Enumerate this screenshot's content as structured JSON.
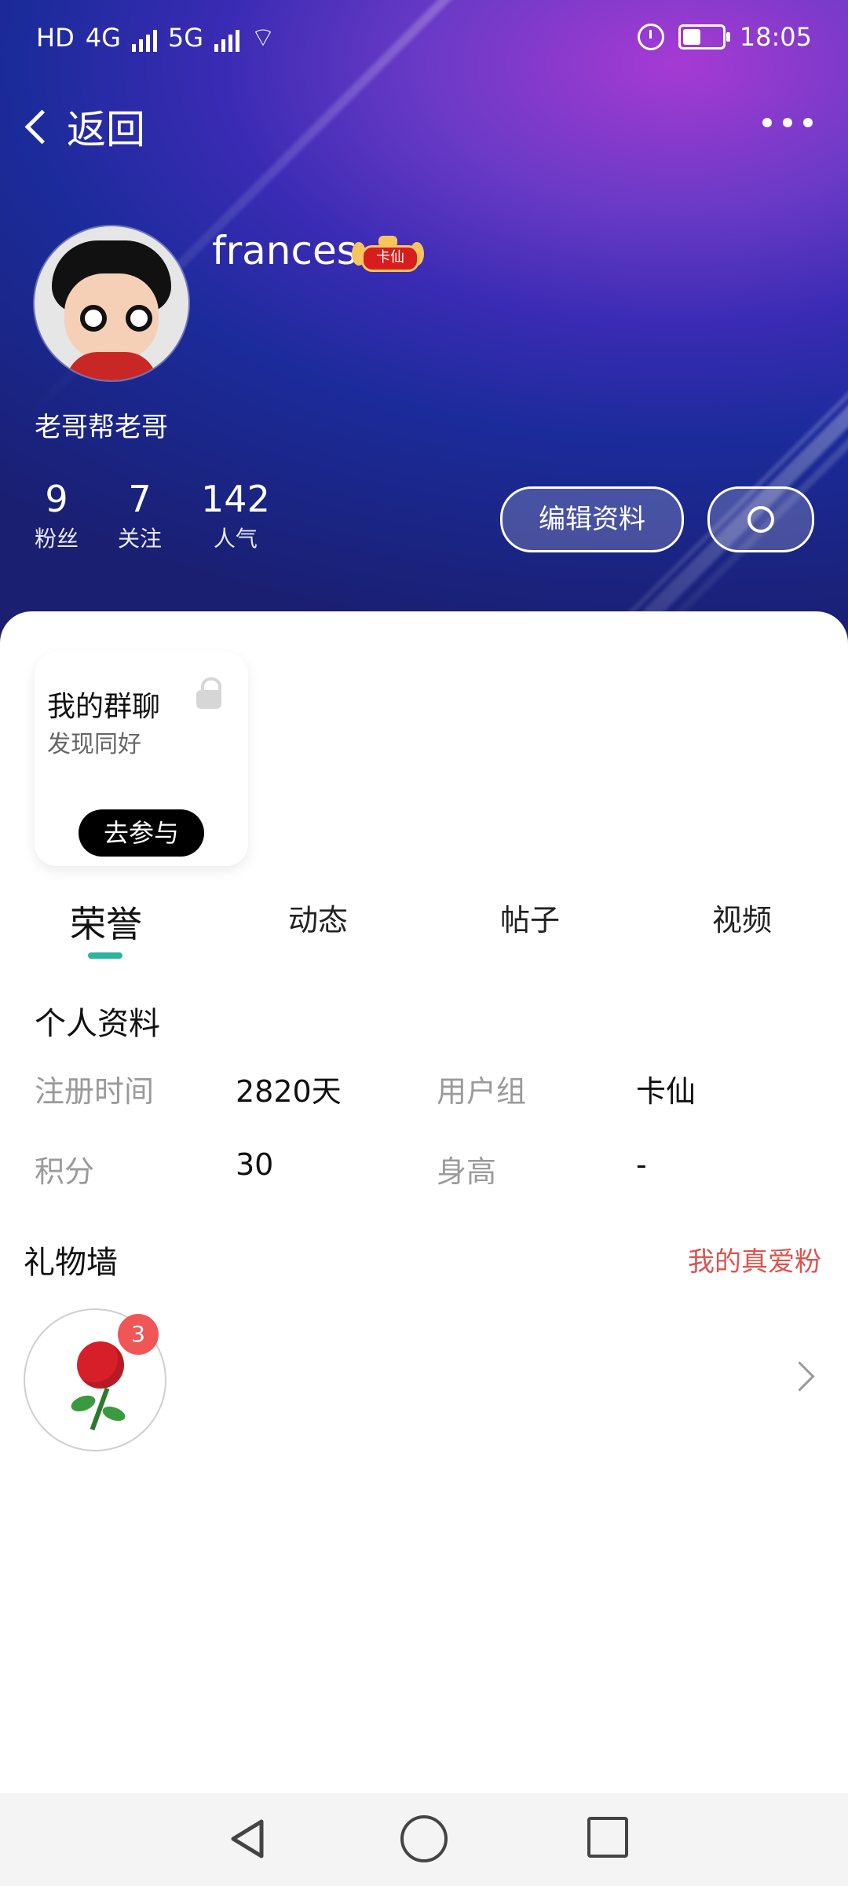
{
  "status_bar": {
    "left_indicators": [
      "HD",
      "4G",
      "5G"
    ],
    "time": "18:05"
  },
  "header": {
    "back_label": "返回",
    "more_icon": "more-dots-icon",
    "username": "frances",
    "rank_badge": "卡仙",
    "bio": "老哥帮老哥",
    "stats": [
      {
        "value": "9",
        "label": "粉丝"
      },
      {
        "value": "7",
        "label": "关注"
      },
      {
        "value": "142",
        "label": "人气"
      }
    ],
    "edit_button": "编辑资料",
    "settings_icon": "gear-icon",
    "colors": {
      "gradient_start": "#1b2b9a",
      "gradient_mid": "#3a2bb4",
      "gradient_end": "#a63ad3"
    }
  },
  "group_card": {
    "title": "我的群聊",
    "subtitle": "发现同好",
    "join_button": "去参与",
    "lock_icon": "lock-icon"
  },
  "tabs": {
    "items": [
      "荣誉",
      "动态",
      "帖子",
      "视频"
    ],
    "active_index": 0,
    "indicator_color": "#2cb59e"
  },
  "profile": {
    "title": "个人资料",
    "fields": [
      {
        "label": "注册时间",
        "value": "2820天"
      },
      {
        "label": "用户组",
        "value": "卡仙"
      },
      {
        "label": "积分",
        "value": "30"
      },
      {
        "label": "身高",
        "value": "-"
      }
    ]
  },
  "gift_wall": {
    "title": "礼物墙",
    "link": "我的真爱粉",
    "link_color": "#e0524e",
    "items": [
      {
        "icon": "rose-icon",
        "count": "3"
      }
    ]
  },
  "nav_bar": {
    "icons": [
      "nav-back-icon",
      "nav-home-icon",
      "nav-recent-icon"
    ]
  }
}
